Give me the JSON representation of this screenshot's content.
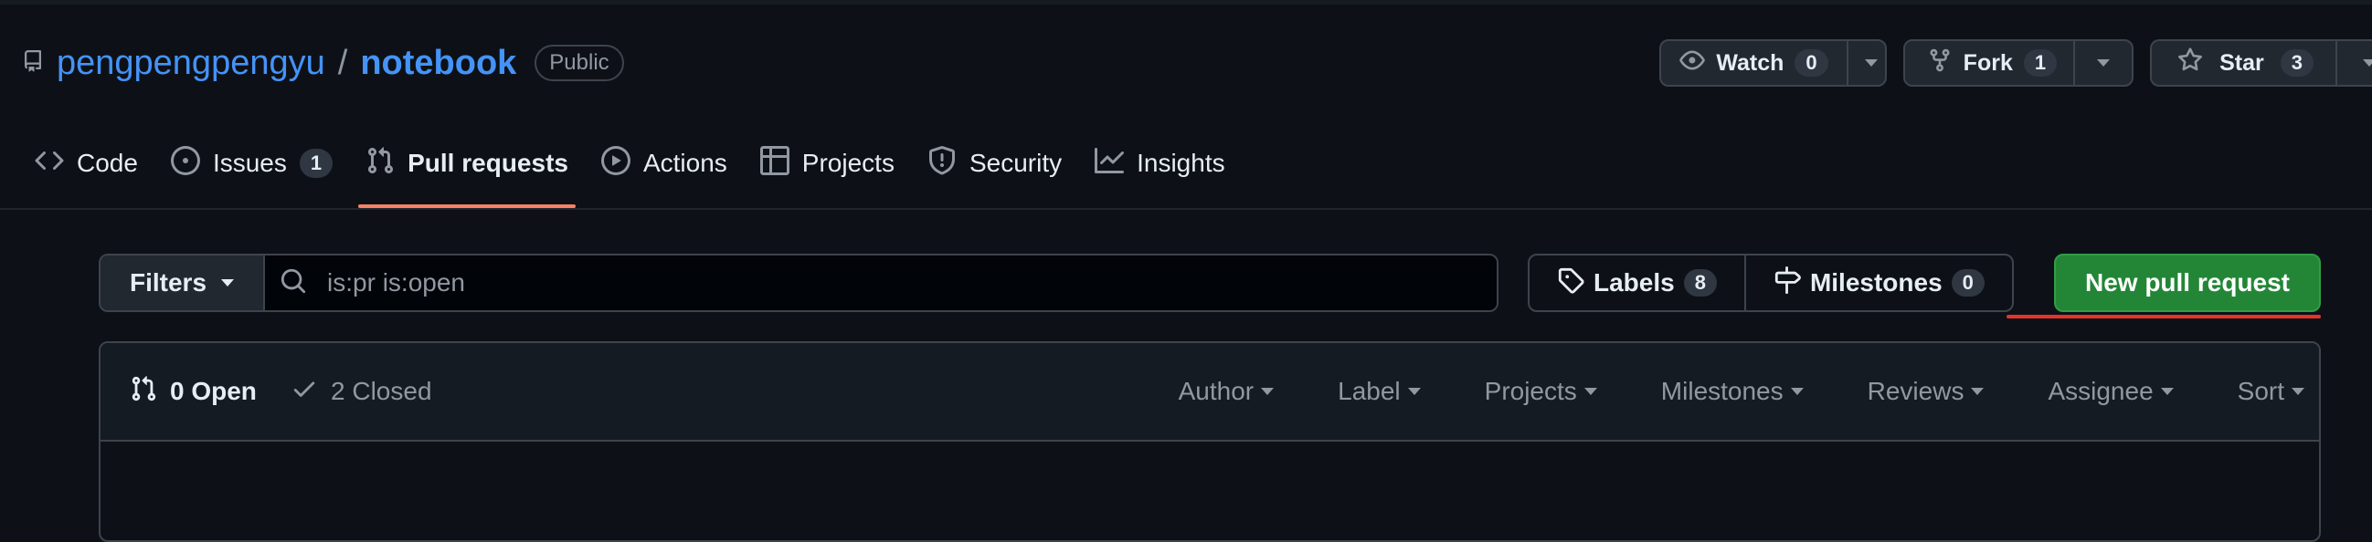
{
  "repo": {
    "owner": "pengpengpengyu",
    "separator": "/",
    "name": "notebook",
    "visibility": "Public",
    "icon": "repo-icon"
  },
  "actions": {
    "watch": {
      "label": "Watch",
      "count": "0",
      "icon": "eye-icon"
    },
    "fork": {
      "label": "Fork",
      "count": "1",
      "icon": "repo-forked-icon"
    },
    "star": {
      "label": "Star",
      "count": "3",
      "icon": "star-icon"
    }
  },
  "nav": {
    "tabs": [
      {
        "label": "Code",
        "icon": "code-icon"
      },
      {
        "label": "Issues",
        "icon": "issue-opened-icon",
        "count": "1"
      },
      {
        "label": "Pull requests",
        "icon": "git-pull-request-icon",
        "active": true
      },
      {
        "label": "Actions",
        "icon": "play-icon"
      },
      {
        "label": "Projects",
        "icon": "table-icon"
      },
      {
        "label": "Security",
        "icon": "shield-icon"
      },
      {
        "label": "Insights",
        "icon": "graph-icon"
      }
    ]
  },
  "subnav": {
    "filters_label": "Filters",
    "search_value": "is:pr is:open",
    "labels_label": "Labels",
    "labels_count": "8",
    "milestones_label": "Milestones",
    "milestones_count": "0",
    "new_pr_label": "New pull request"
  },
  "list": {
    "open_label": "0 Open",
    "closed_label": "2 Closed",
    "filter_menus": [
      "Author",
      "Label",
      "Projects",
      "Milestones",
      "Reviews",
      "Assignee",
      "Sort"
    ]
  },
  "colors": {
    "background": "#0d1117",
    "link": "#4493f8",
    "accent_underline": "#f78166",
    "primary_button": "#238636",
    "highlight_underline": "#e5332a"
  }
}
